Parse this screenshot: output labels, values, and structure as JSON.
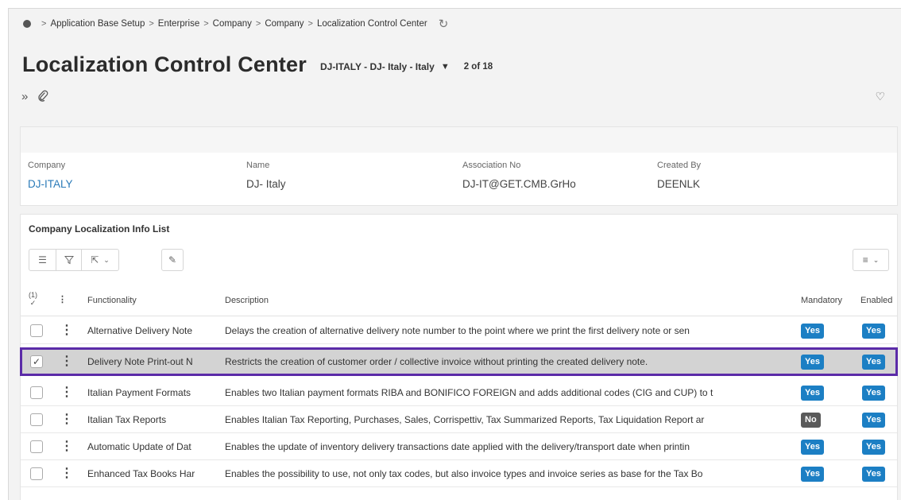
{
  "breadcrumb": [
    "Application Base Setup",
    "Enterprise",
    "Company",
    "Company",
    "Localization Control Center"
  ],
  "page_title": "Localization Control Center",
  "record_selector": "DJ-ITALY - DJ- Italy - Italy",
  "record_count": "2 of 18",
  "header": {
    "fields": [
      {
        "label": "Company",
        "value": "DJ-ITALY"
      },
      {
        "label": "Name",
        "value": "DJ- Italy"
      },
      {
        "label": "Association No",
        "value": "DJ-IT@GET.CMB.GrHo"
      },
      {
        "label": "Created By",
        "value": "DEENLK"
      }
    ]
  },
  "list": {
    "title": "Company Localization Info List",
    "selected_count": "(1)",
    "columns": {
      "functionality": "Functionality",
      "description": "Description",
      "mandatory": "Mandatory",
      "enabled": "Enabled"
    },
    "rows": [
      {
        "functionality": "Alternative Delivery Note",
        "description": "Delays the creation of alternative delivery note number to the point where we print the first delivery note or sen",
        "mandatory": "Yes",
        "enabled": "Yes"
      },
      {
        "functionality": "Delivery Note Print-out N",
        "description": "Restricts the creation of customer order / collective invoice without printing the created delivery note.",
        "mandatory": "Yes",
        "enabled": "Yes"
      },
      {
        "functionality": "Italian Payment Formats",
        "description": "Enables two Italian payment formats RIBA and BONIFICO FOREIGN and adds additional codes (CIG and CUP) to t",
        "mandatory": "Yes",
        "enabled": "Yes"
      },
      {
        "functionality": "Italian Tax Reports",
        "description": "Enables Italian Tax Reporting, Purchases, Sales, Corrispettiv, Tax Summarized Reports, Tax Liquidation Report ar",
        "mandatory": "No",
        "enabled": "Yes"
      },
      {
        "functionality": "Automatic Update of Dat",
        "description": "Enables the update of inventory delivery transactions date applied with the delivery/transport date when printin",
        "mandatory": "Yes",
        "enabled": "Yes"
      },
      {
        "functionality": "Enhanced Tax Books Har",
        "description": "Enables the possibility to use, not only tax codes, but also invoice types and invoice series as base for the Tax Bo",
        "mandatory": "Yes",
        "enabled": "Yes"
      }
    ]
  },
  "colors": {
    "accent_purple": "#5b2ba8",
    "badge_yes": "#1c7fc4",
    "badge_no": "#5a5a5a",
    "link": "#2a7ab8"
  }
}
